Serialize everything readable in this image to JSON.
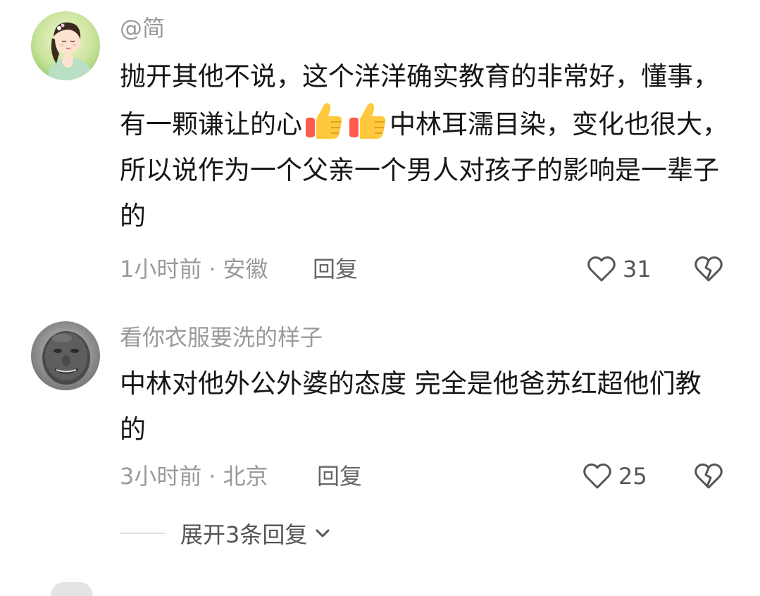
{
  "comments": [
    {
      "username": "@简",
      "text_parts": [
        "抛开其他不说，这个洋洋确实教育的非常好，懂事，有一颗谦让的心",
        "中林耳濡目染，变化也很大，所以说作为一个父亲一个男人对孩子的影响是一辈子的"
      ],
      "emojis": [
        "thumbs-up",
        "thumbs-up"
      ],
      "time": "1小时前",
      "separator": "·",
      "location": "安徽",
      "reply_label": "回复",
      "like_count": "31"
    },
    {
      "username": "看你衣服要洗的样子",
      "text": "中林对他外公外婆的态度 完全是他爸苏红超他们教的",
      "time": "3小时前",
      "separator": "·",
      "location": "北京",
      "reply_label": "回复",
      "like_count": "25"
    }
  ],
  "expand_replies_label": "展开3条回复",
  "icons": {
    "like": "heart-outline-icon",
    "dislike": "broken-heart-icon",
    "expand": "chevron-down-icon"
  },
  "colors": {
    "secondary_text": "#9a9a9a",
    "primary_text": "#161616",
    "icon": "#555555"
  }
}
